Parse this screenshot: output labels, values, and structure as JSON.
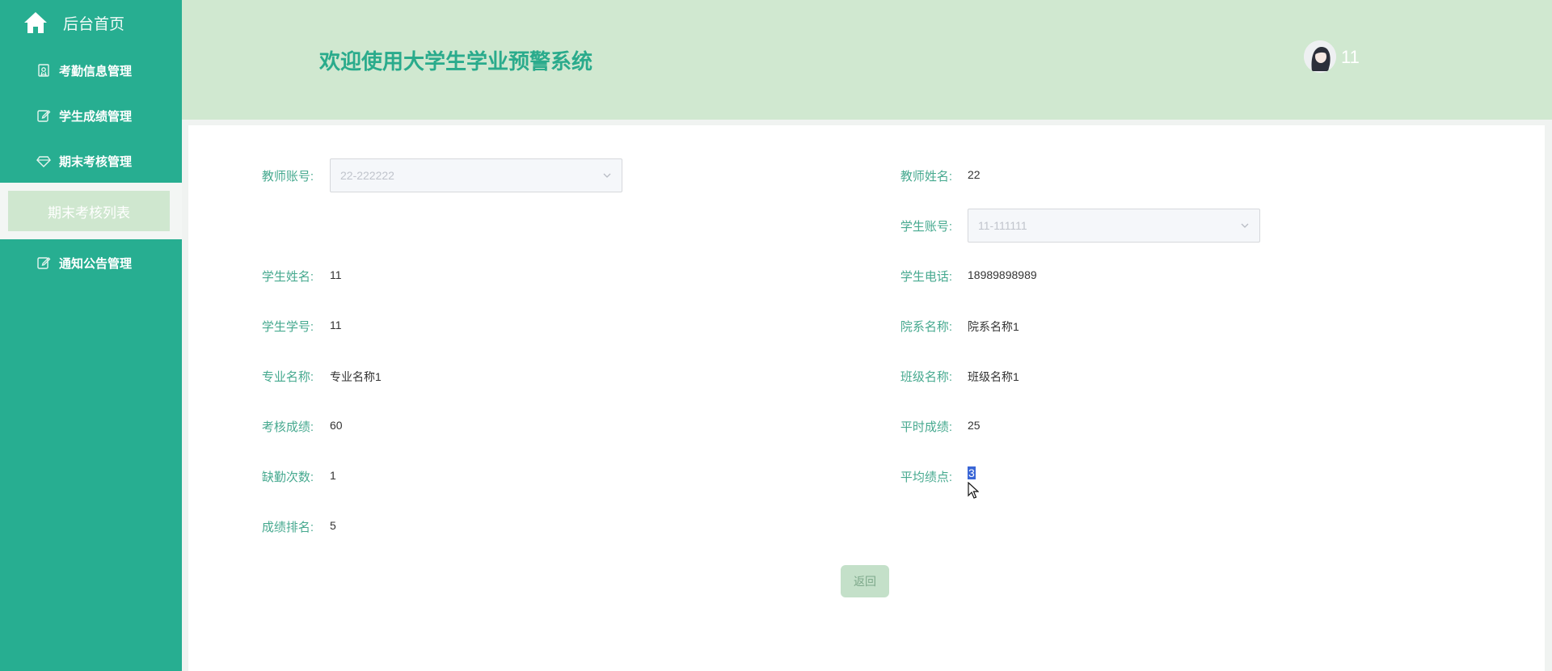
{
  "sidebar": {
    "home_label": "后台首页",
    "items": [
      {
        "label": "考勤信息管理",
        "icon": "badge-icon"
      },
      {
        "label": "学生成绩管理",
        "icon": "edit-icon"
      },
      {
        "label": "期末考核管理",
        "icon": "diamond-icon"
      },
      {
        "label": "通知公告管理",
        "icon": "edit-icon"
      }
    ],
    "submenu": {
      "label": "期末考核列表"
    }
  },
  "header": {
    "title": "欢迎使用大学生学业预警系统",
    "username": "11"
  },
  "form": {
    "teacher_account": {
      "label": "教师账号:",
      "value": "22-222222"
    },
    "teacher_name": {
      "label": "教师姓名:",
      "value": "22"
    },
    "student_account": {
      "label": "学生账号:",
      "value": "11-111111"
    },
    "student_name": {
      "label": "学生姓名:",
      "value": "11"
    },
    "student_phone": {
      "label": "学生电话:",
      "value": "18989898989"
    },
    "student_id": {
      "label": "学生学号:",
      "value": "11"
    },
    "department": {
      "label": "院系名称:",
      "value": "院系名称1"
    },
    "major": {
      "label": "专业名称:",
      "value": "专业名称1"
    },
    "class_name": {
      "label": "班级名称:",
      "value": "班级名称1"
    },
    "exam_score": {
      "label": "考核成绩:",
      "value": "60"
    },
    "usual_score": {
      "label": "平时成绩:",
      "value": "25"
    },
    "absence": {
      "label": "缺勤次数:",
      "value": "1"
    },
    "gpa": {
      "label": "平均绩点:",
      "value": "3"
    },
    "rank": {
      "label": "成绩排名:",
      "value": "5"
    }
  },
  "actions": {
    "back_label": "返回"
  },
  "colors": {
    "sidebar": "#27ae91",
    "header": "#d0e8d0",
    "label": "#46a98f",
    "accent": "#2aab8c"
  }
}
